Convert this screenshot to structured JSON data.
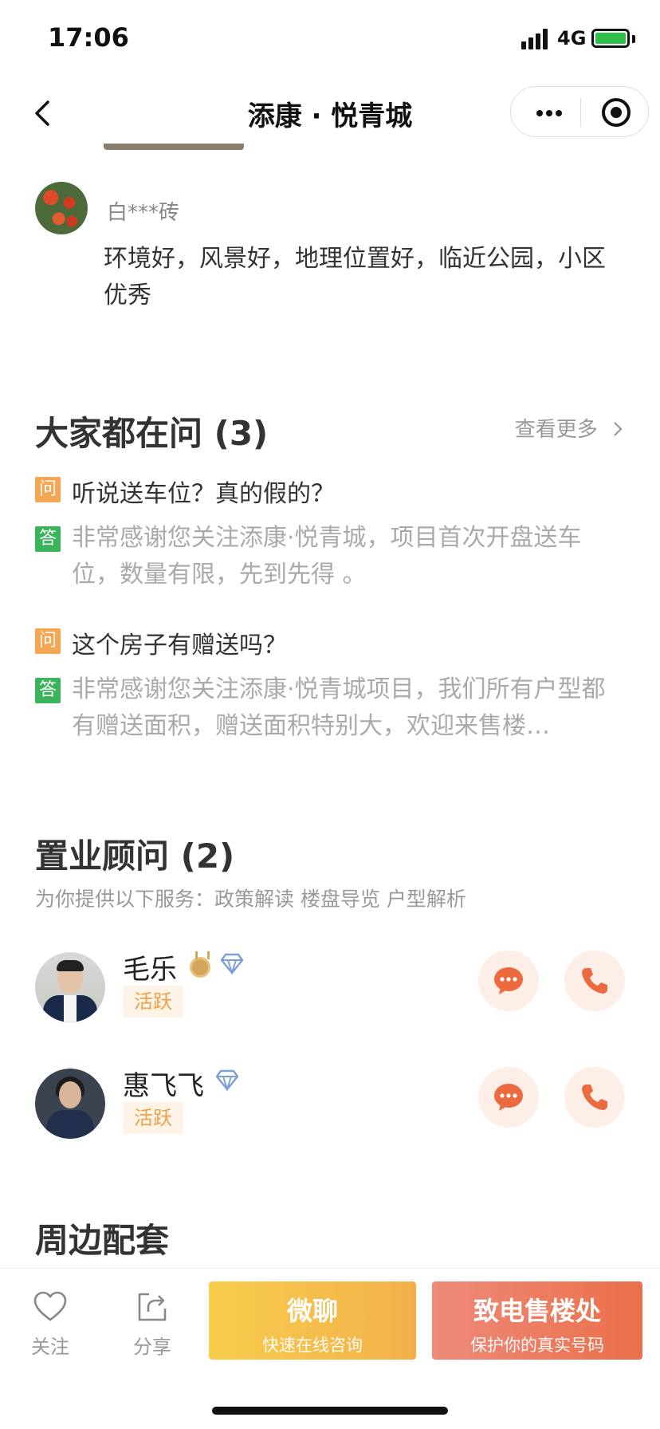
{
  "status": {
    "time": "17:06",
    "network": "4G"
  },
  "nav": {
    "title": "添康 · 悦青城"
  },
  "review": {
    "user": "白***砖",
    "text": "环境好，风景好，地理位置好，临近公园，小区优秀"
  },
  "qa": {
    "title": "大家都在问 (3)",
    "more_label": "查看更多",
    "items": [
      {
        "q_tag": "问",
        "question": "听说送车位？真的假的？",
        "a_tag": "答",
        "answer": "非常感谢您关注添康·悦青城，项目首次开盘送车位，数量有限，先到先得 。"
      },
      {
        "q_tag": "问",
        "question": "这个房子有赠送吗？",
        "a_tag": "答",
        "answer": "非常感谢您关注添康·悦青城项目，我们所有户型都有赠送面积，赠送面积特别大，欢迎来售楼…"
      }
    ]
  },
  "advisors": {
    "title": "置业顾问 (2)",
    "subtitle": "为你提供以下服务：政策解读 楼盘导览 户型解析",
    "items": [
      {
        "name": "毛乐",
        "tag": "活跃"
      },
      {
        "name": "惠飞飞",
        "tag": "活跃"
      }
    ]
  },
  "nearby": {
    "title": "周边配套"
  },
  "bottom_bar": {
    "follow_label": "关注",
    "share_label": "分享",
    "wechat_main": "微聊",
    "wechat_sub": "快速在线咨询",
    "call_main": "致电售楼处",
    "call_sub": "保护你的真实号码"
  },
  "colors": {
    "accent_orange": "#ea7049",
    "question_tag": "#f5a653",
    "answer_tag": "#3ab35b",
    "wechat_button": "#f3b04a",
    "active_tag_text": "#f0a048"
  }
}
